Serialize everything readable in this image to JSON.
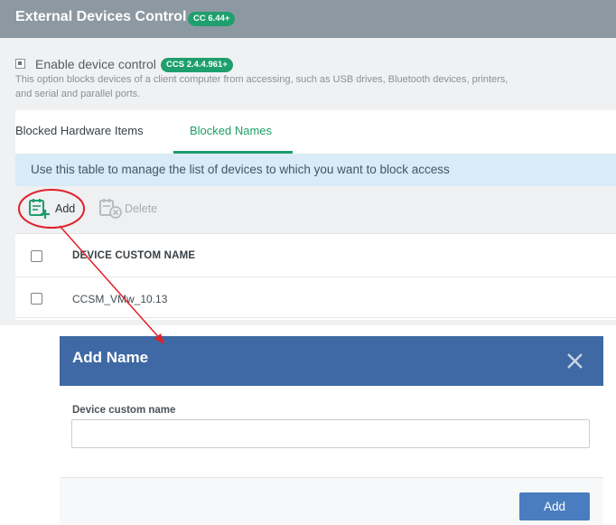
{
  "header": {
    "title": "External Devices Control",
    "badge": "CC 6.44+"
  },
  "enable_control": {
    "label": "Enable device control",
    "badge": "CCS 2.4.4.961+",
    "description": "This option blocks devices of a client computer from accessing, such as USB drives, Bluetooth devices, printers, and serial and parallel ports."
  },
  "tabs": [
    {
      "label": "Blocked Hardware Items",
      "active": false
    },
    {
      "label": "Blocked Names",
      "active": true
    }
  ],
  "info_text": "Use this table to manage the list of devices to which you want to block access",
  "toolbar": {
    "add_label": "Add",
    "delete_label": "Delete"
  },
  "table": {
    "column_header": "DEVICE CUSTOM NAME",
    "rows": [
      {
        "name": "CCSM_VMw_10.13"
      }
    ]
  },
  "modal": {
    "title": "Add Name",
    "field_label": "Device custom name",
    "field_value": "",
    "submit_label": "Add"
  },
  "colors": {
    "accent_green": "#1d9d6b",
    "modal_header": "#3e69a4",
    "primary_button": "#4a7cc0",
    "annotation_red": "#e0202a"
  }
}
